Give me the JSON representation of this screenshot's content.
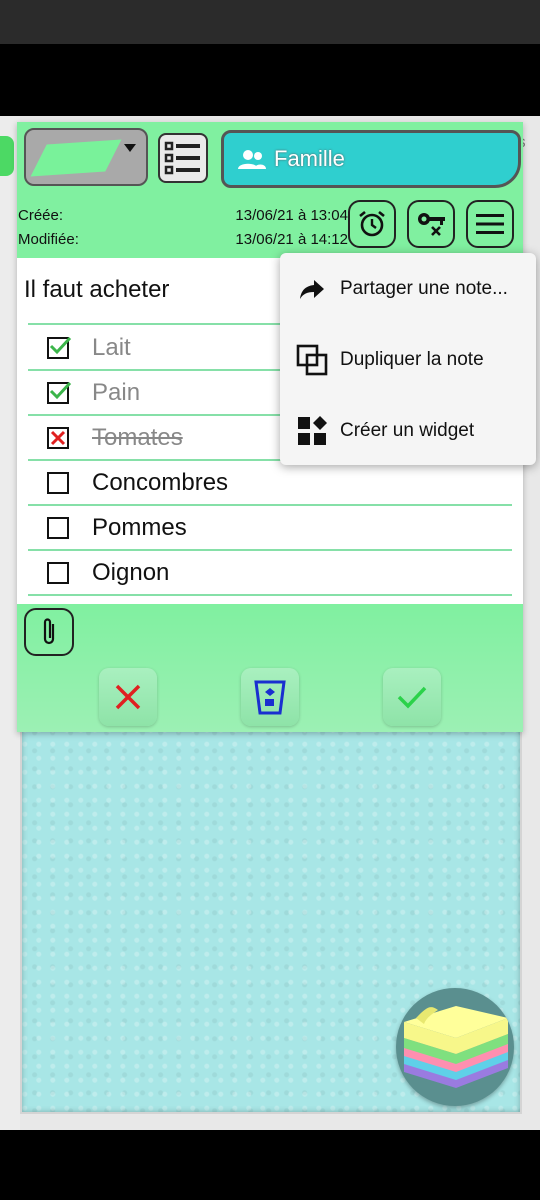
{
  "header": {
    "category": "Famille",
    "created_label": "Créée:",
    "created_value": "13/06/21 à 13:04",
    "modified_label": "Modifiée:",
    "modified_value": "13/06/21 à 14:12"
  },
  "note": {
    "title": "Il faut acheter",
    "items": [
      {
        "label": "Lait",
        "state": "checked"
      },
      {
        "label": "Pain",
        "state": "checked"
      },
      {
        "label": "Tomates",
        "state": "crossed"
      },
      {
        "label": "Concombres",
        "state": "unchecked"
      },
      {
        "label": "Pommes",
        "state": "unchecked"
      },
      {
        "label": "Oignon",
        "state": "unchecked"
      }
    ]
  },
  "menu": {
    "items": [
      {
        "label": "Partager une note...",
        "icon": "share-icon"
      },
      {
        "label": "Dupliquer la note",
        "icon": "duplicate-icon"
      },
      {
        "label": "Créer un widget",
        "icon": "widget-icon"
      }
    ]
  },
  "colors": {
    "header_green": "#80f0a0",
    "category_teal": "#2fcfcf",
    "board": "#a8e6e6",
    "check_green": "#3bb54a",
    "cancel_red": "#e02020",
    "trash_blue": "#1a2fd0",
    "confirm_green": "#2bd24a"
  }
}
